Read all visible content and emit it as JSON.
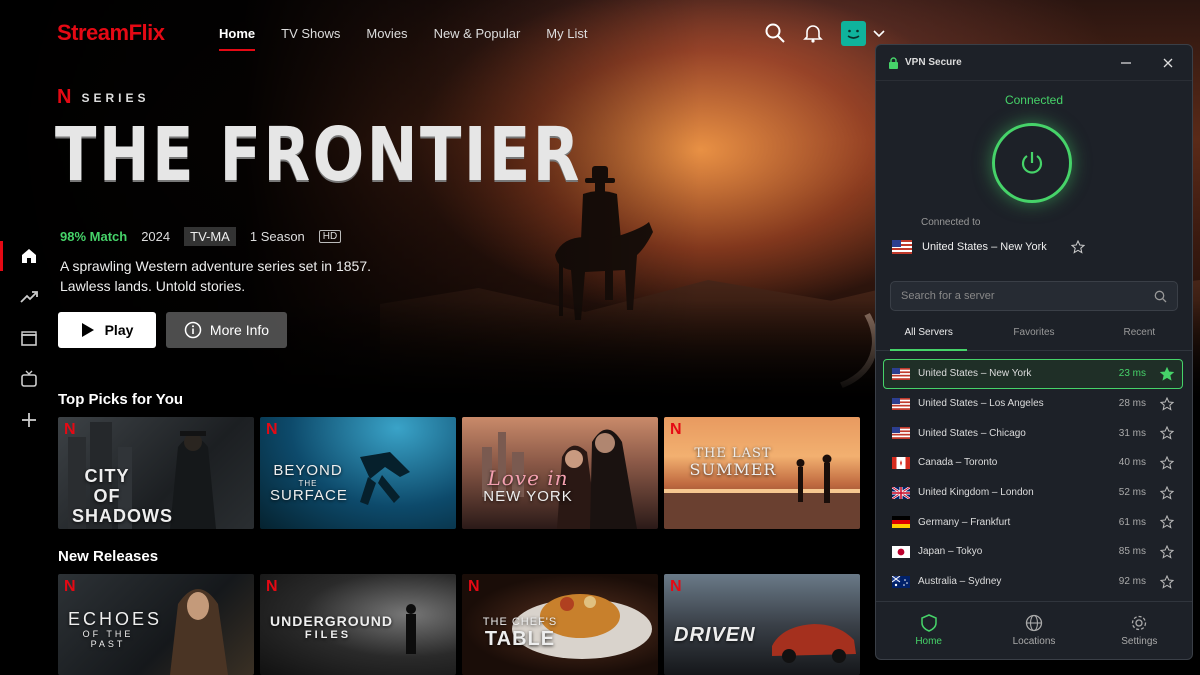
{
  "app": {
    "brand": "StreamFlix"
  },
  "nav": {
    "items": [
      "Home",
      "TV Shows",
      "Movies",
      "New & Popular",
      "My List"
    ],
    "active": "Home"
  },
  "hero": {
    "badge_logo": "N",
    "badge_text": "SERIES",
    "title": "THE FRONTIER",
    "match": "98% Match",
    "year": "2024",
    "rating": "TV-MA",
    "seasons": "1 Season",
    "quality": "HD",
    "description_line1": "A sprawling Western adventure series set in 1857.",
    "description_line2": "Lawless lands. Untold stories.",
    "play_label": "Play",
    "info_label": "More Info"
  },
  "rows": [
    {
      "title": "Top Picks for You",
      "tiles": [
        {
          "title_line1": "CITY OF",
          "title_line2": "SHADOWS"
        },
        {
          "title_line1": "BEYOND",
          "title_mid": "THE",
          "title_line2": "SURFACE"
        },
        {
          "title_line1": "Love in",
          "title_line2": "NEW YORK"
        },
        {
          "title_line1": "THE LAST",
          "title_line2": "SUMMER"
        }
      ]
    },
    {
      "title": "New Releases",
      "tiles": [
        {
          "title_line1": "ECHOES",
          "title_line2": "OF THE PAST"
        },
        {
          "title_line1": "UNDERGROUND",
          "title_line2": "FILES"
        },
        {
          "title_line1": "THE CHEF'S",
          "title_line2": "TABLE"
        },
        {
          "title_line1": "DRIVEN",
          "title_line2": ""
        }
      ]
    }
  ],
  "vpn": {
    "title": "VPN Secure",
    "status": "Connected",
    "connected_to_label": "Connected to",
    "connected_location": "United States – New York",
    "search_placeholder": "Search for a server",
    "tabs": [
      "All Servers",
      "Favorites",
      "Recent"
    ],
    "servers": [
      {
        "name": "United States – New York",
        "ms": "23 ms",
        "flag": "us",
        "fav": true
      },
      {
        "name": "United States – Los Angeles",
        "ms": "28 ms",
        "flag": "us",
        "fav": false
      },
      {
        "name": "United States – Chicago",
        "ms": "31 ms",
        "flag": "us",
        "fav": false
      },
      {
        "name": "Canada – Toronto",
        "ms": "40 ms",
        "flag": "ca",
        "fav": false
      },
      {
        "name": "United Kingdom – London",
        "ms": "52 ms",
        "flag": "gb",
        "fav": false
      },
      {
        "name": "Germany – Frankfurt",
        "ms": "61 ms",
        "flag": "de",
        "fav": false
      },
      {
        "name": "Japan – Tokyo",
        "ms": "85 ms",
        "flag": "jp",
        "fav": false
      },
      {
        "name": "Australia – Sydney",
        "ms": "92 ms",
        "flag": "au",
        "fav": false
      }
    ],
    "footer": [
      "Home",
      "Locations",
      "Settings"
    ],
    "accent": "#46d369"
  },
  "colors": {
    "brand": "#e50914",
    "match": "#46d369"
  }
}
